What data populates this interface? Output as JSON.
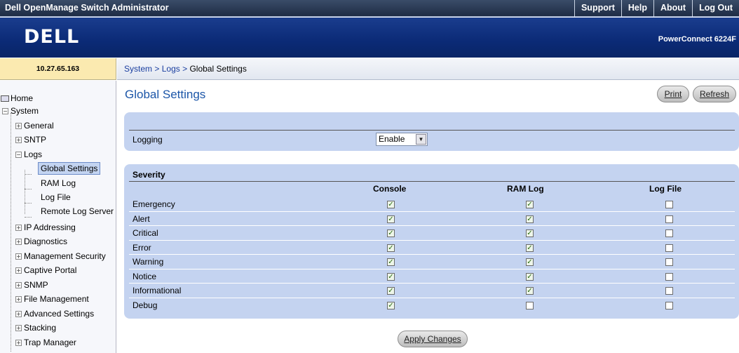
{
  "topbar": {
    "title": "Dell OpenManage Switch Administrator",
    "links": [
      "Support",
      "Help",
      "About",
      "Log Out"
    ]
  },
  "banner": {
    "logo": "DELL",
    "model": "PowerConnect 6224F"
  },
  "ip_address": "10.27.65.163",
  "breadcrumb": {
    "items": [
      "System",
      "Logs"
    ],
    "separator": ">",
    "current": "Global Settings"
  },
  "sidebar": {
    "items": [
      {
        "label": "Home",
        "level": 0,
        "expander": "none"
      },
      {
        "label": "System",
        "level": 0,
        "expander": "minus"
      },
      {
        "label": "General",
        "level": 1,
        "expander": "plus"
      },
      {
        "label": "SNTP",
        "level": 1,
        "expander": "plus"
      },
      {
        "label": "Logs",
        "level": 1,
        "expander": "minus"
      },
      {
        "label": "Global Settings",
        "level": 2,
        "expander": "none",
        "selected": true
      },
      {
        "label": "RAM Log",
        "level": 2,
        "expander": "none"
      },
      {
        "label": "Log File",
        "level": 2,
        "expander": "none"
      },
      {
        "label": "Remote Log Server",
        "level": 2,
        "expander": "none"
      },
      {
        "label": "IP Addressing",
        "level": 1,
        "expander": "plus"
      },
      {
        "label": "Diagnostics",
        "level": 1,
        "expander": "plus"
      },
      {
        "label": "Management Security",
        "level": 1,
        "expander": "plus"
      },
      {
        "label": "Captive Portal",
        "level": 1,
        "expander": "plus"
      },
      {
        "label": "SNMP",
        "level": 1,
        "expander": "plus"
      },
      {
        "label": "File Management",
        "level": 1,
        "expander": "plus"
      },
      {
        "label": "Advanced Settings",
        "level": 1,
        "expander": "plus"
      },
      {
        "label": "Stacking",
        "level": 1,
        "expander": "plus"
      },
      {
        "label": "Trap Manager",
        "level": 1,
        "expander": "plus"
      }
    ]
  },
  "main": {
    "title": "Global Settings",
    "print_label": "Print",
    "refresh_label": "Refresh",
    "logging": {
      "label": "Logging",
      "value": "Enable"
    },
    "severity": {
      "header": "Severity",
      "columns": [
        "Console",
        "RAM Log",
        "Log File"
      ],
      "rows": [
        {
          "name": "Emergency",
          "console": true,
          "ram_log": true,
          "log_file": false
        },
        {
          "name": "Alert",
          "console": true,
          "ram_log": true,
          "log_file": false
        },
        {
          "name": "Critical",
          "console": true,
          "ram_log": true,
          "log_file": false
        },
        {
          "name": "Error",
          "console": true,
          "ram_log": true,
          "log_file": false
        },
        {
          "name": "Warning",
          "console": true,
          "ram_log": true,
          "log_file": false
        },
        {
          "name": "Notice",
          "console": true,
          "ram_log": true,
          "log_file": false
        },
        {
          "name": "Informational",
          "console": true,
          "ram_log": true,
          "log_file": false
        },
        {
          "name": "Debug",
          "console": true,
          "ram_log": false,
          "log_file": false
        }
      ]
    },
    "apply_label": "Apply Changes"
  },
  "colors": {
    "topbar": "#1e2c45",
    "banner": "#0b2a76",
    "panel": "#c4d3f0",
    "title": "#1c56a8",
    "ip_box": "#fbeab0"
  }
}
